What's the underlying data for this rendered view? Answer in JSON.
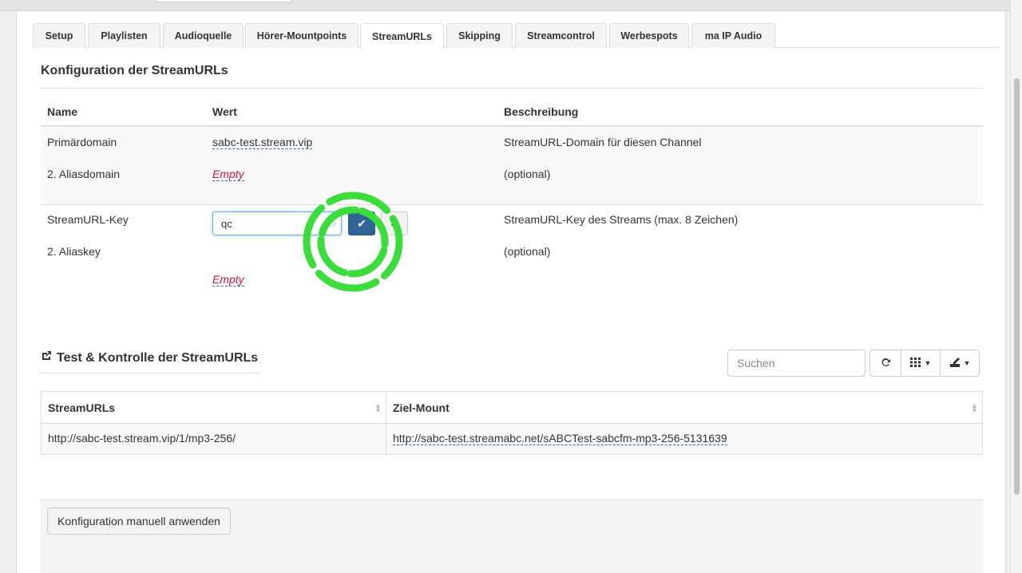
{
  "tabs": [
    {
      "label": "Setup"
    },
    {
      "label": "Playlisten"
    },
    {
      "label": "Audioquelle"
    },
    {
      "label": "Hörer-Mountpoints"
    },
    {
      "label": "StreamURLs",
      "active": true
    },
    {
      "label": "Skipping"
    },
    {
      "label": "Streamcontrol"
    },
    {
      "label": "Werbespots"
    },
    {
      "label": "ma IP Audio"
    }
  ],
  "config": {
    "title": "Konfiguration der StreamURLs",
    "headers": {
      "name": "Name",
      "value": "Wert",
      "description": "Beschreibung"
    },
    "rows": [
      {
        "name": "Primärdomain",
        "value": "sabc-test.stream.vip",
        "description": "StreamURL-Domain für diesen Channel"
      },
      {
        "name": "2. Aliasdomain",
        "value": "Empty",
        "description": "(optional)"
      },
      {
        "name": "StreamURL-Key",
        "value": "qc",
        "description": "StreamURL-Key des Streams (max. 8 Zeichen)"
      },
      {
        "name": "2. Aliaskey",
        "value": "Empty",
        "description": "(optional)"
      }
    ],
    "editor": {
      "input_value": "qc",
      "ok_icon": "check-icon",
      "cancel_icon": "times-icon"
    }
  },
  "test": {
    "title": "Test & Kontrolle der StreamURLs",
    "search_placeholder": "Suchen",
    "toolbar_icons": [
      "refresh-icon",
      "columns-icon",
      "export-icon"
    ],
    "columns": [
      "StreamURLs",
      "Ziel-Mount"
    ],
    "rows": [
      [
        "http://sabc-test.stream.vip/1/mp3-256/",
        "http://sabc-test.streamabc.net/sABCTest-sabcfm-mp3-256-5131639"
      ]
    ]
  },
  "footer": {
    "apply_button": "Konfiguration manuell anwenden"
  },
  "colors": {
    "primary_button": "#2f6494",
    "empty_text": "#c4163f",
    "spinner": "#3ddc3d"
  }
}
